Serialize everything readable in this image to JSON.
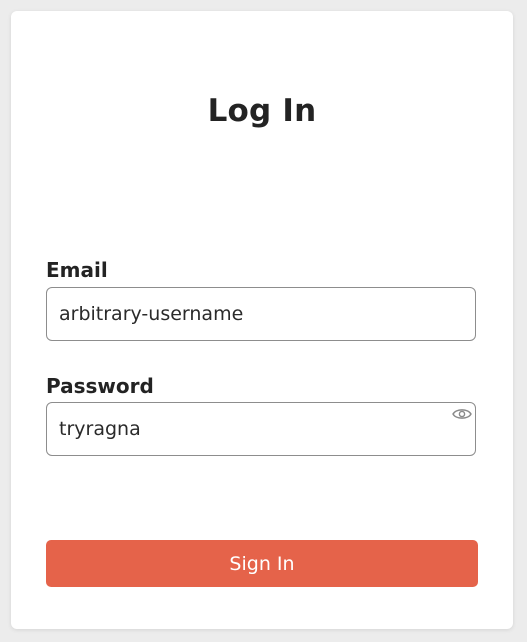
{
  "form": {
    "title": "Log In",
    "email": {
      "label": "Email",
      "value": "arbitrary-username"
    },
    "password": {
      "label": "Password",
      "value": "tryragna",
      "toggle_icon": "eye-icon"
    },
    "submit_label": "Sign In"
  },
  "colors": {
    "accent": "#e5634a",
    "background": "#ececec",
    "card": "#ffffff",
    "text": "#232323",
    "input_border": "#8d8d8d"
  }
}
